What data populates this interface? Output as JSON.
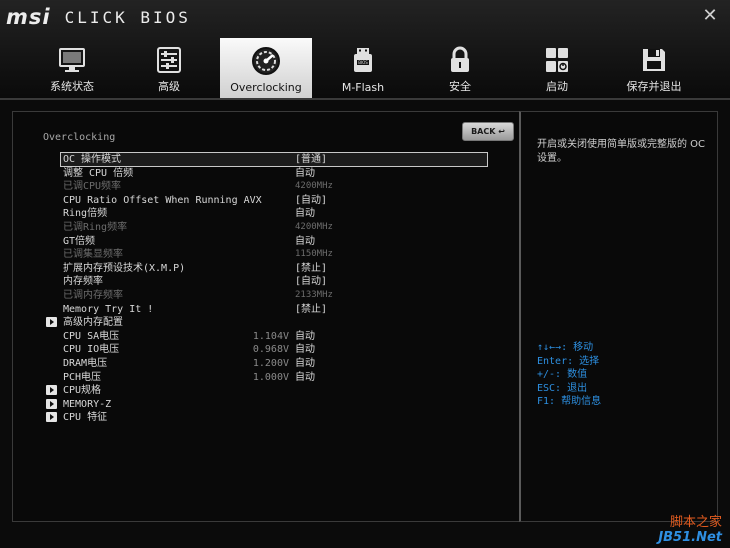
{
  "brand": {
    "logo": "msi",
    "product": "CLICK BIOS"
  },
  "nav": {
    "tabs": [
      {
        "label": "系统状态",
        "icon": "monitor-icon"
      },
      {
        "label": "高级",
        "icon": "sliders-icon"
      },
      {
        "label": "Overclocking",
        "icon": "speedometer-icon",
        "active": true
      },
      {
        "label": "M-Flash",
        "icon": "usb-icon"
      },
      {
        "label": "安全",
        "icon": "lock-icon"
      },
      {
        "label": "启动",
        "icon": "power-grid-icon"
      },
      {
        "label": "保存并退出",
        "icon": "floppy-icon"
      }
    ]
  },
  "main": {
    "section_title": "Overclocking",
    "back_label": "BACK ↩",
    "rows": [
      {
        "label": "OC 操作模式",
        "value": "[普通]",
        "selected": true
      },
      {
        "label": "调整 CPU 倍频",
        "value": "自动"
      },
      {
        "label": "已调CPU频率",
        "value": "4200MHz",
        "disabled": true
      },
      {
        "label": "CPU Ratio Offset When Running AVX",
        "value": "[自动]"
      },
      {
        "label": "Ring倍频",
        "value": "自动"
      },
      {
        "label": "已调Ring频率",
        "value": "4200MHz",
        "disabled": true
      },
      {
        "label": "GT倍频",
        "value": "自动"
      },
      {
        "label": "已调集显频率",
        "value": "1150MHz",
        "disabled": true
      },
      {
        "label": "扩展内存预设技术(X.M.P)",
        "value": "[禁止]"
      },
      {
        "label": "内存频率",
        "value": "[自动]"
      },
      {
        "label": "已调内存频率",
        "value": "2133MHz",
        "disabled": true
      },
      {
        "label": "Memory Try It !",
        "value": "[禁止]"
      },
      {
        "label": "高级内存配置",
        "submenu": true
      },
      {
        "label": "CPU SA电压",
        "volt": "1.104V",
        "value": "自动"
      },
      {
        "label": "CPU IO电压",
        "volt": "0.968V",
        "value": "自动"
      },
      {
        "label": "DRAM电压",
        "volt": "1.200V",
        "value": "自动"
      },
      {
        "label": "PCH电压",
        "volt": "1.000V",
        "value": "自动"
      },
      {
        "label": "CPU规格",
        "submenu": true
      },
      {
        "label": "MEMORY-Z",
        "submenu": true
      },
      {
        "label": "CPU 特征",
        "submenu": true
      }
    ]
  },
  "help": {
    "description": "开启或关闭使用简单版或完整版的 OC 设置。",
    "keys": [
      "↑↓←→: 移动",
      "Enter: 选择",
      "+/-: 数值",
      "ESC: 退出",
      "F1: 帮助信息"
    ]
  },
  "watermark": {
    "line1": "脚本之家",
    "line2": "JB51.Net"
  }
}
